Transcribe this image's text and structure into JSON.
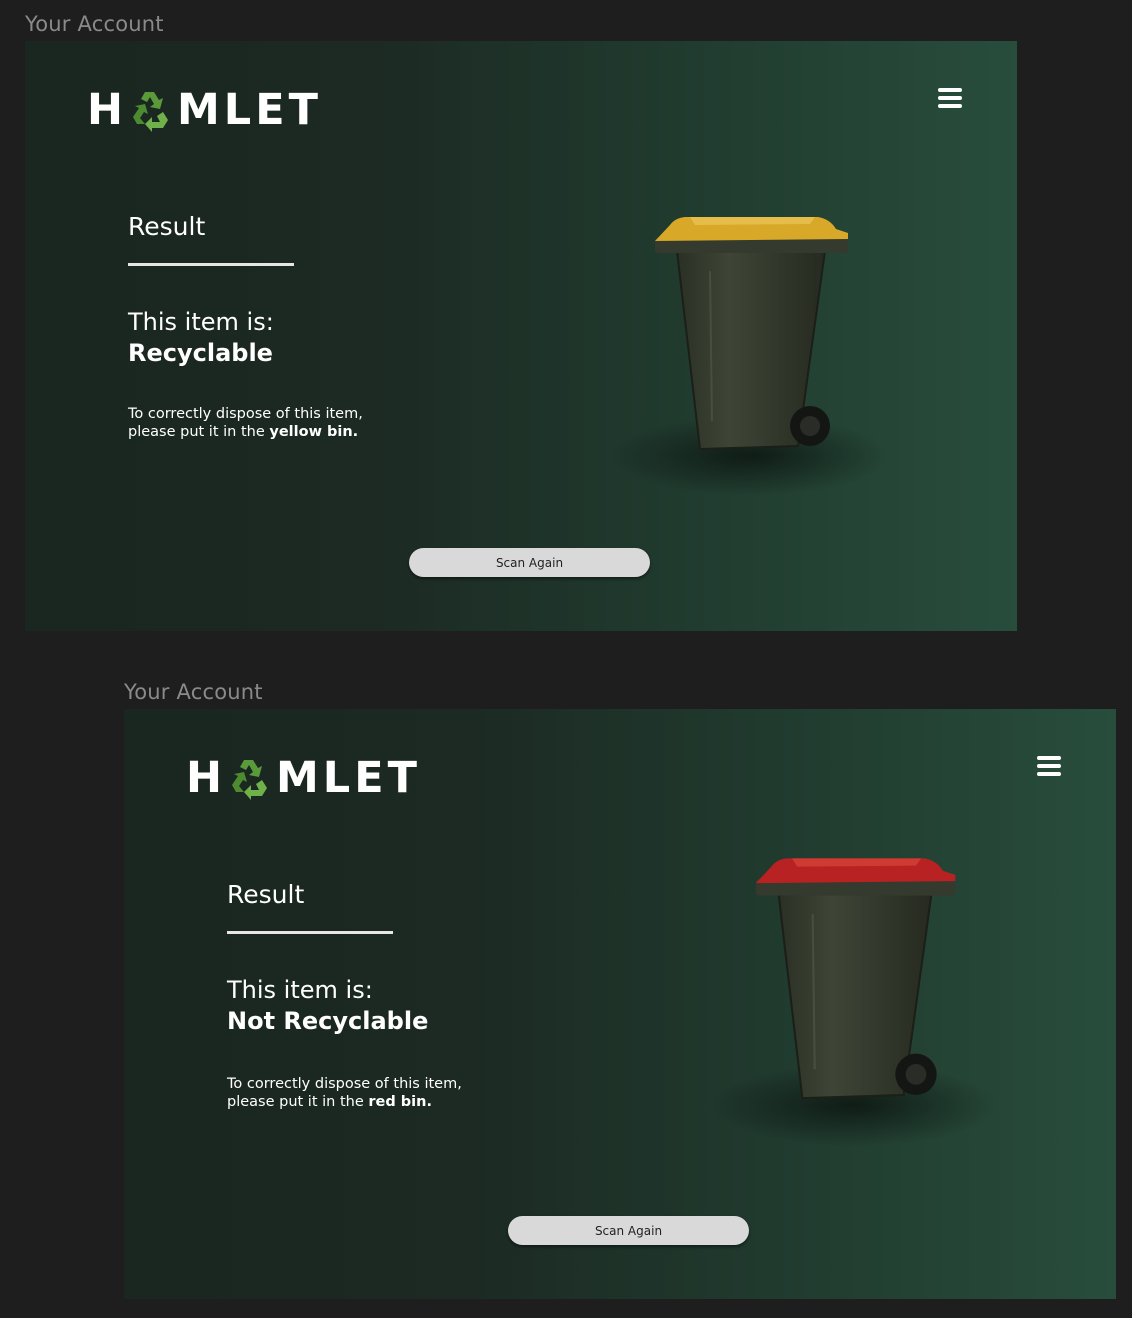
{
  "frames": [
    {
      "frame_label": "Your Account",
      "logo": {
        "text_before": "H",
        "text_after": "MLET",
        "icon": "recycle-icon"
      },
      "menu_icon": "hamburger-menu-icon",
      "result_title": "Result",
      "item_is_label": "This item is:",
      "verdict": "Recyclable",
      "instruction_line1": "To correctly dispose of this item,",
      "instruction_line2_prefix": "please put it in the ",
      "instruction_bin": "yellow bin.",
      "bin_lid_color": "#d8a928",
      "scan_again_label": "Scan Again"
    },
    {
      "frame_label": "Your Account",
      "logo": {
        "text_before": "H",
        "text_after": "MLET",
        "icon": "recycle-icon"
      },
      "menu_icon": "hamburger-menu-icon",
      "result_title": "Result",
      "item_is_label": "This item is:",
      "verdict": "Not Recyclable",
      "instruction_line1": "To correctly dispose of this item,",
      "instruction_line2_prefix": "please put it in the ",
      "instruction_bin": "red bin.",
      "bin_lid_color": "#b82222",
      "scan_again_label": "Scan Again"
    }
  ],
  "colors": {
    "canvas_bg": "#1e1e1e",
    "frame_gradient_start": "#1a2620",
    "frame_gradient_end": "#284d3c",
    "logo_recycle_green": "#5a9a3a",
    "button_bg": "#d9d9d9"
  }
}
